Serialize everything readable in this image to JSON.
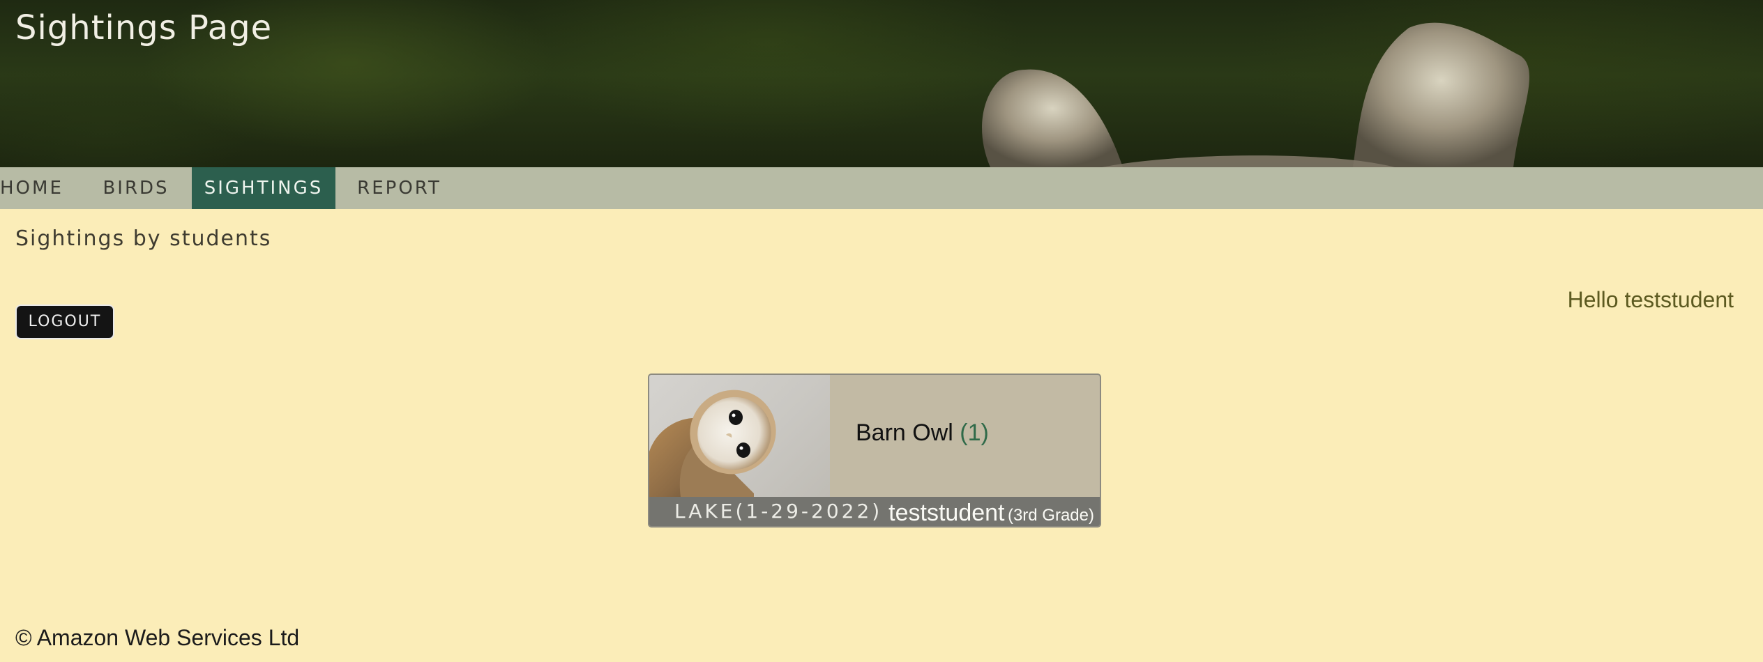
{
  "header": {
    "title": "Sightings Page"
  },
  "nav": {
    "items": [
      {
        "label": "HOME"
      },
      {
        "label": "BIRDS"
      },
      {
        "label": "SIGHTINGS",
        "active": true
      },
      {
        "label": "REPORT"
      }
    ]
  },
  "main": {
    "subheading": "Sightings by students",
    "greeting": "Hello teststudent",
    "logout_label": "LOGOUT"
  },
  "sighting": {
    "bird": "Barn Owl",
    "count": "(1)",
    "location": "LAKE(1-29-2022)",
    "student": "teststudent",
    "grade": "(3rd Grade)"
  },
  "footer": {
    "copyright": "© Amazon Web Services Ltd"
  },
  "colors": {
    "background": "#fbedb8",
    "nav_bar": "#b7bba5",
    "nav_active": "#2c5f4e",
    "card": "#c2baa4",
    "card_footer": "#74746f",
    "count_accent": "#2f6a49"
  }
}
